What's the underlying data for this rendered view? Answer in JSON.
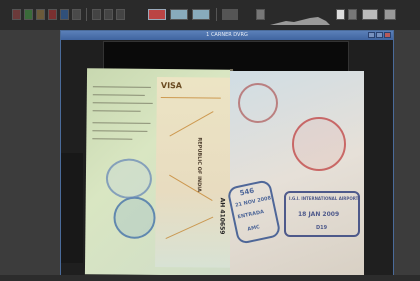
{
  "window": {
    "title": "1 CARNER DVRG"
  },
  "toolbar": {
    "buttons": [
      "undo-icon",
      "redo-icon",
      "crop-icon",
      "rotate-icon",
      "save-icon",
      "print-icon",
      "zoom-icon",
      "layout-single-icon",
      "layout-double-icon",
      "settings-icon",
      "histogram-icon",
      "brightness-icon",
      "contrast-icon",
      "color-icon"
    ]
  },
  "passport": {
    "visa_label": "VISA",
    "visa_country": "REPUBLIC OF INDIA",
    "visa_number": "AH 410659",
    "stamp_546": "546",
    "stamp_entry_date": "21 NOV 2008",
    "stamp_entrada": "ENTRADA",
    "stamp_code": "AMC",
    "stamp_airport": "I.G.I. INTERNATIONAL AIRPORT",
    "stamp_airport_date": "18 JAN 2009",
    "stamp_code2": "D19"
  }
}
